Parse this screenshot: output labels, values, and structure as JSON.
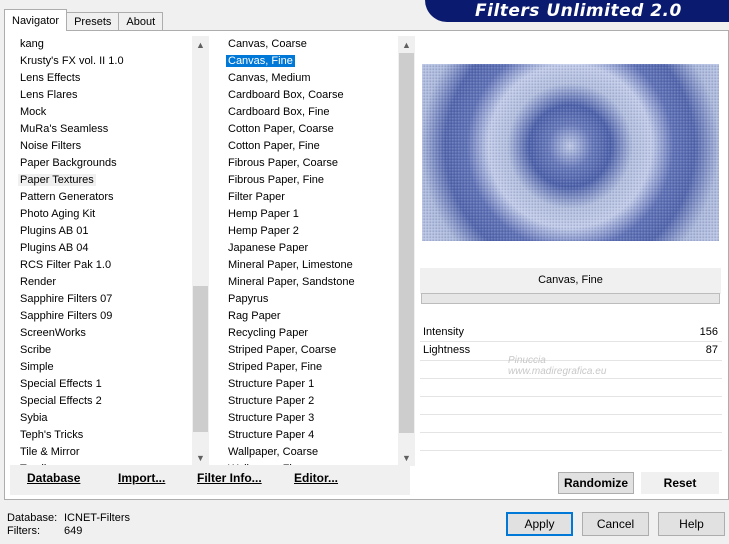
{
  "window": {
    "banner_title": "Filters Unlimited 2.0"
  },
  "tabs": [
    {
      "label": "Navigator",
      "active": true
    },
    {
      "label": "Presets",
      "active": false
    },
    {
      "label": "About",
      "active": false
    }
  ],
  "categories": {
    "items": [
      "kang",
      "Krusty's FX vol. II 1.0",
      "Lens Effects",
      "Lens Flares",
      "Mock",
      "MuRa's Seamless",
      "Noise Filters",
      "Paper Backgrounds",
      "Paper Textures",
      "Pattern Generators",
      "Photo Aging Kit",
      "Plugins AB 01",
      "Plugins AB 04",
      "RCS Filter Pak 1.0",
      "Render",
      "Sapphire Filters 07",
      "Sapphire Filters 09",
      "ScreenWorks",
      "Scribe",
      "Simple",
      "Special Effects 1",
      "Special Effects 2",
      "Sybia",
      "Teph's Tricks",
      "Tile & Mirror",
      "Toadies"
    ],
    "selected": "Paper Textures"
  },
  "filters": {
    "items": [
      "Canvas, Coarse",
      "Canvas, Fine",
      "Canvas, Medium",
      "Cardboard Box, Coarse",
      "Cardboard Box, Fine",
      "Cotton Paper, Coarse",
      "Cotton Paper, Fine",
      "Fibrous Paper, Coarse",
      "Fibrous Paper, Fine",
      "Filter Paper",
      "Hemp Paper 1",
      "Hemp Paper 2",
      "Japanese Paper",
      "Mineral Paper, Limestone",
      "Mineral Paper, Sandstone",
      "Papyrus",
      "Rag Paper",
      "Recycling Paper",
      "Striped Paper, Coarse",
      "Striped Paper, Fine",
      "Structure Paper 1",
      "Structure Paper 2",
      "Structure Paper 3",
      "Structure Paper 4",
      "Wallpaper, Coarse",
      "Wallpaper, Fine"
    ],
    "selected": "Canvas, Fine"
  },
  "toolbar": {
    "database": "Database",
    "import": "Import...",
    "filter_info": "Filter Info...",
    "editor": "Editor..."
  },
  "filter_panel": {
    "name": "Canvas, Fine",
    "params": [
      {
        "label": "Intensity",
        "value": "156"
      },
      {
        "label": "Lightness",
        "value": "87"
      }
    ],
    "randomize": "Randomize",
    "reset": "Reset"
  },
  "watermark": {
    "line1": "Pinuccia",
    "line2": "www.madiregrafica.eu"
  },
  "footer": {
    "database_label": "Database:",
    "database_value": "ICNET-Filters",
    "filters_label": "Filters:",
    "filters_value": "649",
    "apply": "Apply",
    "cancel": "Cancel",
    "help": "Help"
  },
  "colors": {
    "accent": "#0078d7",
    "banner": "#0a1a6e",
    "preview_light": "#b7c3e2",
    "preview_dark": "#5468b0"
  }
}
